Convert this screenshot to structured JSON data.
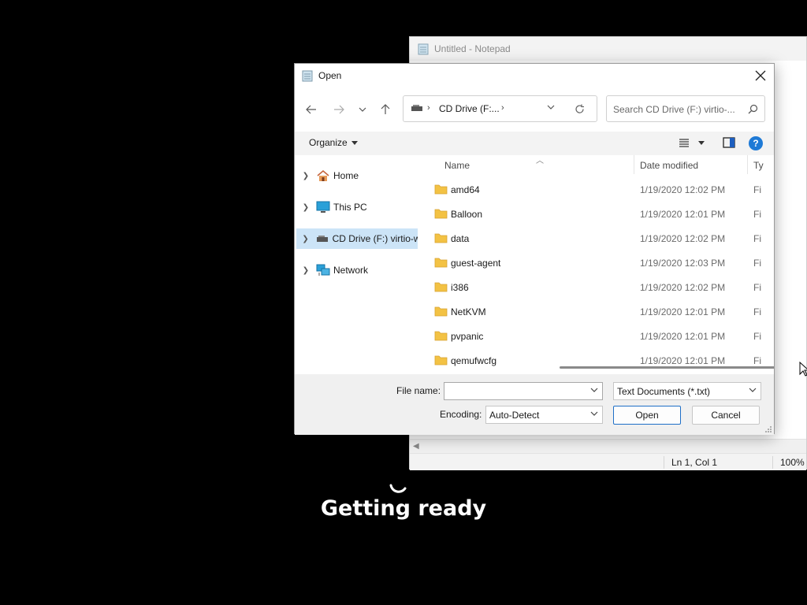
{
  "notepad": {
    "title": "Untitled - Notepad",
    "status": {
      "position": "Ln 1, Col 1",
      "zoom": "100%"
    }
  },
  "dialog": {
    "title": "Open",
    "address": {
      "path": "CD Drive (F:..."
    },
    "search": {
      "placeholder": "Search CD Drive (F:) virtio-..."
    },
    "organize_label": "Organize",
    "help_label": "?",
    "nav": [
      {
        "label": "Home",
        "icon": "home-icon"
      },
      {
        "label": "This PC",
        "icon": "this-pc-icon"
      },
      {
        "label": "CD Drive (F:) virtio-w",
        "icon": "cd-drive-icon",
        "selected": true
      },
      {
        "label": "Network",
        "icon": "network-icon"
      }
    ],
    "columns": {
      "name": "Name",
      "date": "Date modified",
      "type": "Ty"
    },
    "files": [
      {
        "name": "amd64",
        "date": "1/19/2020 12:02 PM",
        "type": "Fi"
      },
      {
        "name": "Balloon",
        "date": "1/19/2020 12:01 PM",
        "type": "Fi"
      },
      {
        "name": "data",
        "date": "1/19/2020 12:02 PM",
        "type": "Fi"
      },
      {
        "name": "guest-agent",
        "date": "1/19/2020 12:03 PM",
        "type": "Fi"
      },
      {
        "name": "i386",
        "date": "1/19/2020 12:02 PM",
        "type": "Fi"
      },
      {
        "name": "NetKVM",
        "date": "1/19/2020 12:01 PM",
        "type": "Fi"
      },
      {
        "name": "pvpanic",
        "date": "1/19/2020 12:01 PM",
        "type": "Fi"
      },
      {
        "name": "qemufwcfg",
        "date": "1/19/2020 12:01 PM",
        "type": "Fi"
      }
    ],
    "file_name_label": "File name:",
    "file_name_value": "",
    "filter_value": "Text Documents (*.txt)",
    "encoding_label": "Encoding:",
    "encoding_value": "Auto-Detect",
    "open_label": "Open",
    "cancel_label": "Cancel"
  },
  "overlay": {
    "message": "Getting ready"
  },
  "colors": {
    "accent": "#1e7ad6",
    "selection": "#cce4f7",
    "folder": "#f3c244"
  }
}
